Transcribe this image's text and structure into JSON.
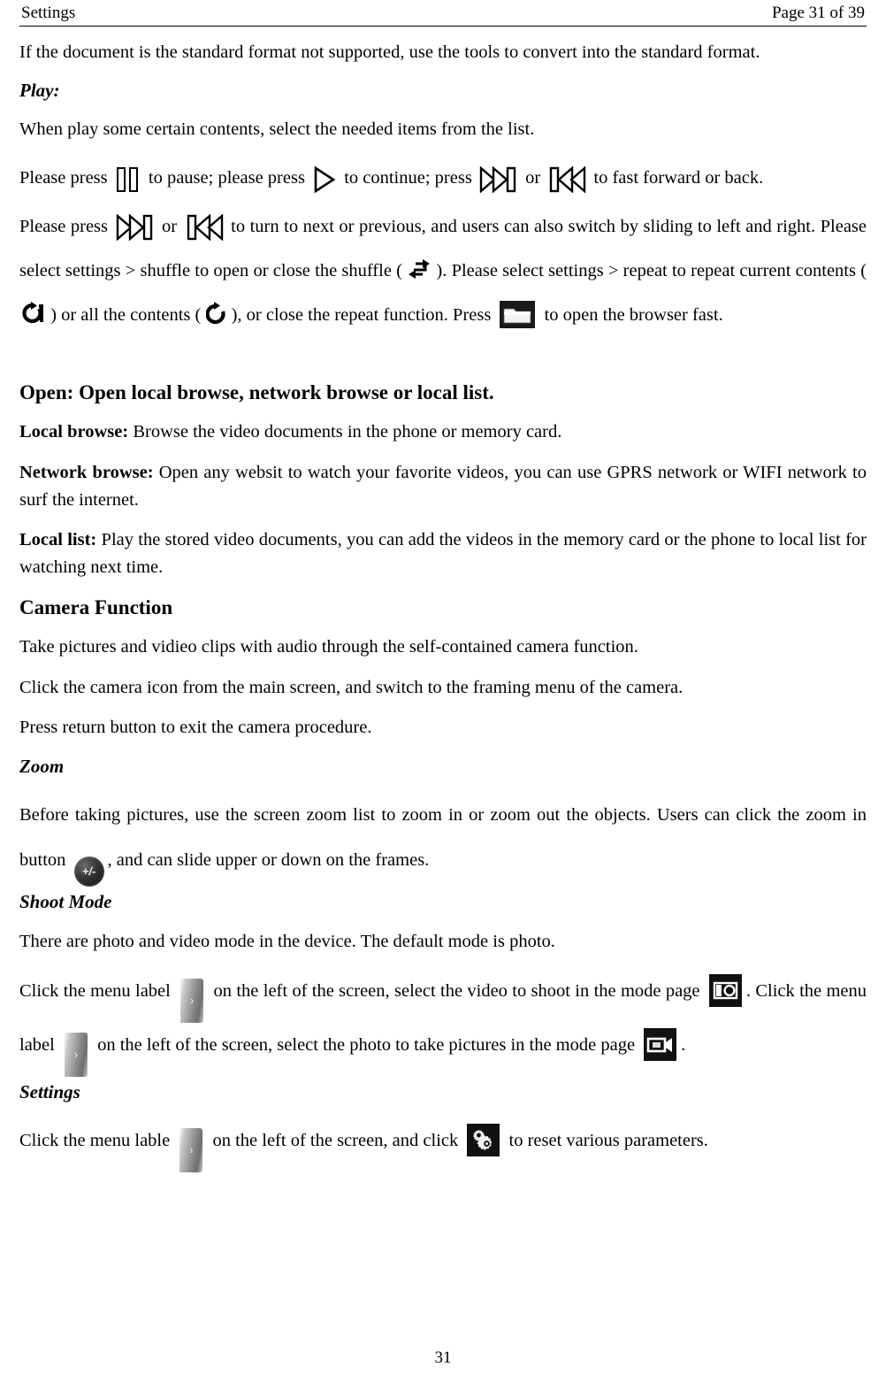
{
  "header": {
    "left_title": "Settings",
    "right_pageinfo": "Page 31 of 39"
  },
  "footer": {
    "page_number": "31"
  },
  "content": {
    "intro_paragraph": "If the document is the standard format not supported, use the tools to convert into the standard format.",
    "play_heading": "Play:",
    "play_intro": "When play some certain contents, select the needed items from the list.",
    "play_controls": {
      "t1": "Please press",
      "t2": "to pause; please press",
      "t3": "to continue; press",
      "t4": "or",
      "t5": "to fast forward or back."
    },
    "navigation": {
      "t1": "Please press",
      "t2": "or",
      "t3": "to turn to next or previous, and users can also switch by sliding to left and right. Please select settings > shuffle to open or close the shuffle (",
      "t4": "). Please select settings > repeat to repeat current contents (",
      "t5": ") or all the contents (",
      "t6": "), or close the repeat function. Press",
      "t7": "to open the browser fast."
    },
    "open_heading": "Open: Open local browse, network browse or local list.",
    "local_browse": {
      "label": "Local browse:",
      "text": " Browse the video documents in the phone or memory card."
    },
    "network_browse": {
      "label": "Network browse:",
      "text": " Open any websit to watch your favorite videos, you can use GPRS network or WIFI network to surf the internet."
    },
    "local_list": {
      "label": "Local list:",
      "text": " Play the stored video documents, you can add the videos in the memory card or the phone to local list for watching next time."
    },
    "camera_function_heading": "Camera Function",
    "camera_p1": "Take pictures and vidieo clips with audio through the self-contained camera function.",
    "camera_p2": "Click the camera icon from the main screen, and switch to the framing menu of the camera.",
    "camera_p3": "Press return button to exit the camera procedure.",
    "zoom_heading": "Zoom",
    "zoom_text": {
      "t1": "Before taking pictures, use the screen zoom list to zoom in or zoom out the objects. Users can click the zoom in button",
      "t2": ", and can slide upper or down on the frames."
    },
    "shoot_mode_heading": "Shoot Mode",
    "shoot_mode_p1": "There are photo and video mode in the device. The default mode is photo.",
    "shoot_mode_p2": {
      "t1": "Click the menu label",
      "t2": "on the left of the screen, select the video to shoot in the mode page",
      "t3": ". Click the menu label",
      "t4": "on the left of the screen, select the photo to take pictures in the mode page",
      "t5": "."
    },
    "settings_heading": "Settings",
    "settings_text": {
      "t1": "Click the menu lable",
      "t2": "on the left of the screen, and click",
      "t3": "to reset various parameters."
    }
  },
  "icons": {
    "pause": "pause-icon",
    "play": "play-icon",
    "fast_forward": "fast-forward-icon",
    "rewind": "rewind-icon",
    "shuffle": "shuffle-icon",
    "repeat_one": "repeat-one-icon",
    "repeat_all": "repeat-all-icon",
    "folder": "folder-icon",
    "zoom_button_label": "+/-",
    "menu_label_chevron": "›",
    "camera": "camera-icon",
    "video_camera": "video-camera-icon",
    "gear": "gear-icon"
  }
}
